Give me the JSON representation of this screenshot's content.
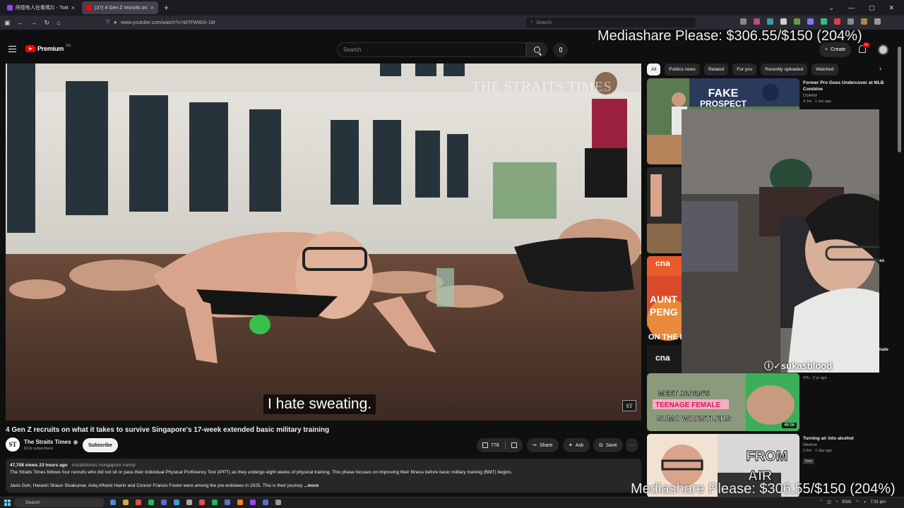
{
  "browser": {
    "tabs": [
      {
        "title": "阿德有人在看嗎片 - Twitch",
        "active": false,
        "favicon_color": "#9146ff"
      },
      {
        "title": "(37) 4 Gen Z recruits on wh",
        "active": true,
        "favicon_color": "#ff0000"
      }
    ],
    "new_tab": "+",
    "url": "www.youtube.com/watch?v=M7FWI6IX-1M",
    "search_placeholder": "Search"
  },
  "youtube": {
    "brand": "Premium",
    "country": "SG",
    "search_placeholder": "Search",
    "create_label": "Create",
    "notification_count": "9+"
  },
  "overlay": {
    "mediashare_top": "Mediashare Please: $306.55/$150 (204%)",
    "mediashare_bottom": "Mediashare Please: $306.55/$150 (204%)",
    "handle": "sukasblood"
  },
  "player": {
    "watermark": "THE STRAITS TIMES",
    "subtitle": "I hate sweating.",
    "corner_badge": "ST"
  },
  "video": {
    "title": "4 Gen Z recruits on what it takes to survive Singapore's 17-week extended basic military training",
    "channel": "The Straits Times",
    "channel_logo": "ST",
    "subscribers": "811k subscribers",
    "subscribe_label": "Subscribe",
    "likes": "778",
    "share_label": "Share",
    "ask_label": "Ask",
    "save_label": "Save",
    "more_label": "···"
  },
  "description": {
    "meta": "47,708 views  23 hours ago",
    "tags": "#straitstimes #singapore #army",
    "line1": "The Straits Times follows four recruits who did not sit or pass their Individual Physical Proficiency Test (IPPT) as they undergo eight weeks of physical training. This phase focuses on improving their fitness before basic military training (BMT) begins.",
    "line2": "Javis Goh, Haravin Shaun Sivakumar, Aniq Afhami Hamir and Connor Francis Foster were among the pre-enlistees in 2025. This is their journey",
    "more": "...more"
  },
  "chips": [
    "All",
    "Politics news",
    "Related",
    "For you",
    "Recently uploaded",
    "Watched"
  ],
  "recommendations": [
    {
      "title": "Former Pro Goes Undercover at MLB Combine",
      "channel": "DSARM",
      "views": "4.1m · 1 mo ago",
      "thumb_text1": "FAKE",
      "thumb_text2": "PROSPECT"
    },
    {
      "title": "",
      "channel": "",
      "views": ""
    },
    {
      "title": "",
      "channel": "",
      "views": "",
      "thumb_text1": "AUNT",
      "thumb_text2": "PENG",
      "thumb_text3": "ON THE RED",
      "logo": "cna"
    },
    {
      "title": "",
      "channel": "",
      "views": "47k · 2 yr ago",
      "logo": "cna"
    },
    {
      "title": "",
      "channel": "",
      "views": "",
      "thumb_text1": "MEET JAPAN'S",
      "thumb_text2": "TEENAGE FEMALE",
      "thumb_text3": "SUMO WRESTLERS",
      "duration": "46:56"
    },
    {
      "title": "Turning air into alcohol",
      "channel": "NileRed",
      "views": "2.6m · 1 day ago",
      "badge": "New",
      "thumb_text1": "FROM",
      "thumb_text2": "AIR"
    }
  ],
  "partial_labels": {
    "right_edge_1": "as",
    "right_edge_2": "male"
  },
  "taskbar": {
    "search_placeholder": "Search",
    "lang": "ENG",
    "time": "7:31 pm"
  }
}
